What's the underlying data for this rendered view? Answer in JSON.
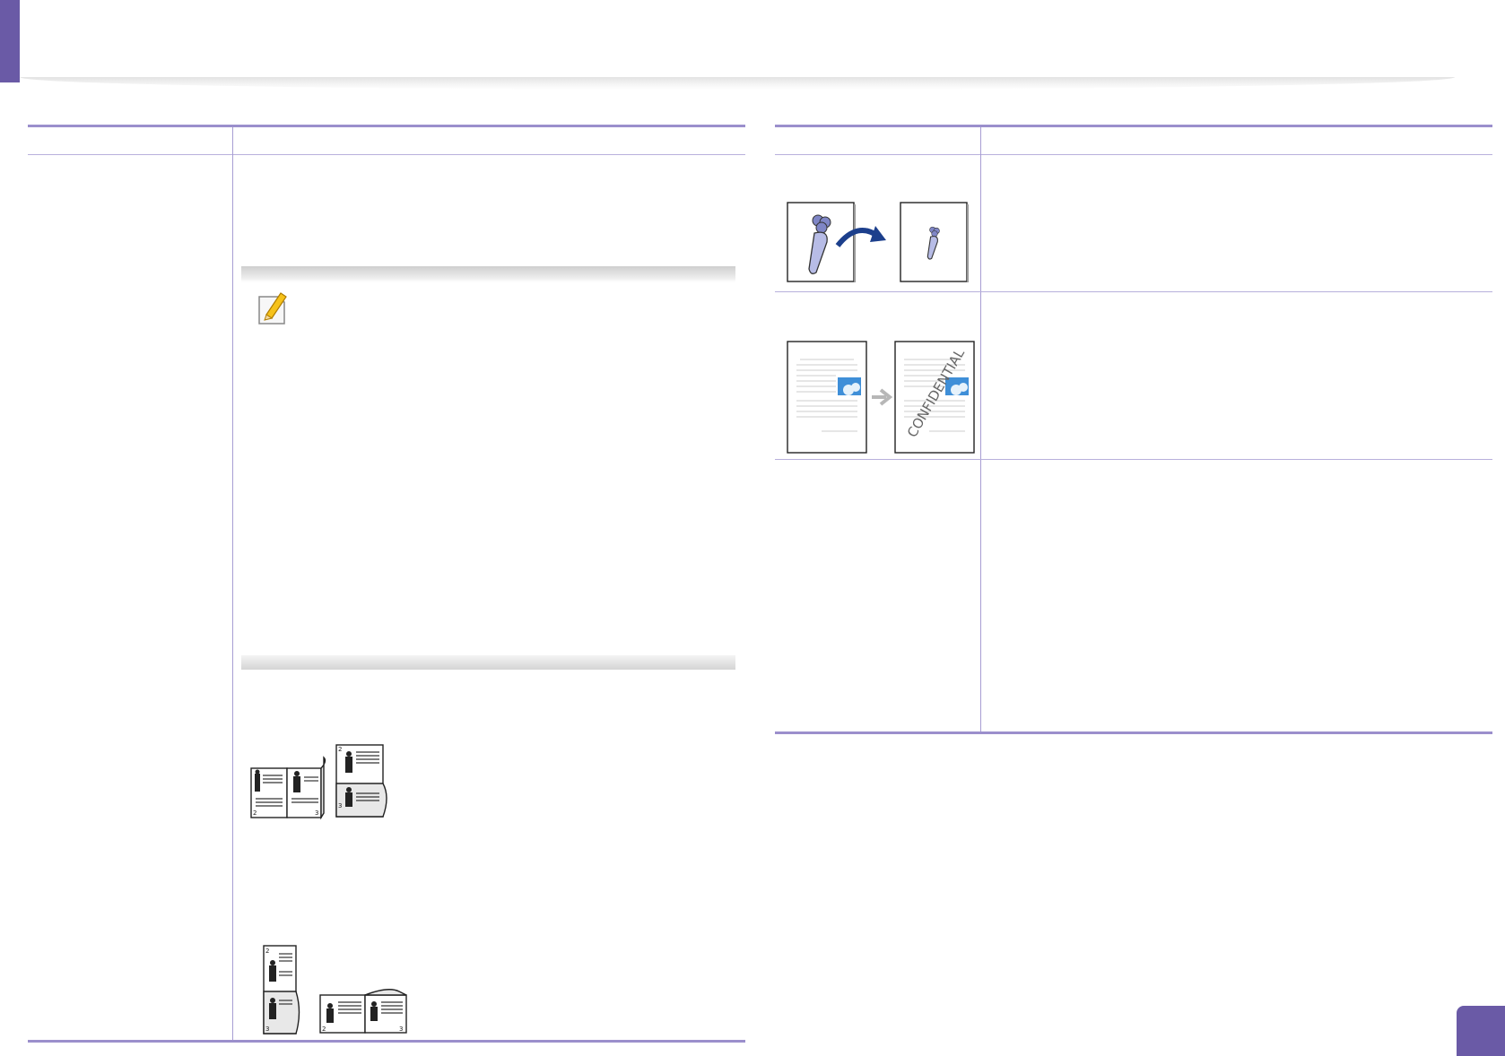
{
  "header": {
    "accent_color": "#6a5aa6"
  },
  "table_rule_color": "#9b8fcc",
  "icons": {
    "note": "note-pencil-icon",
    "reduce": "image-reduce-arrow-icon",
    "watermark": "watermark-arrow-icon"
  },
  "watermark_example": {
    "text": "CONFIDENTIAL"
  },
  "booklet_page_numbers": {
    "a": [
      "2",
      "3"
    ],
    "b": [
      "2",
      "3"
    ],
    "c": [
      "2",
      "3"
    ],
    "d": [
      "2",
      "3"
    ]
  }
}
